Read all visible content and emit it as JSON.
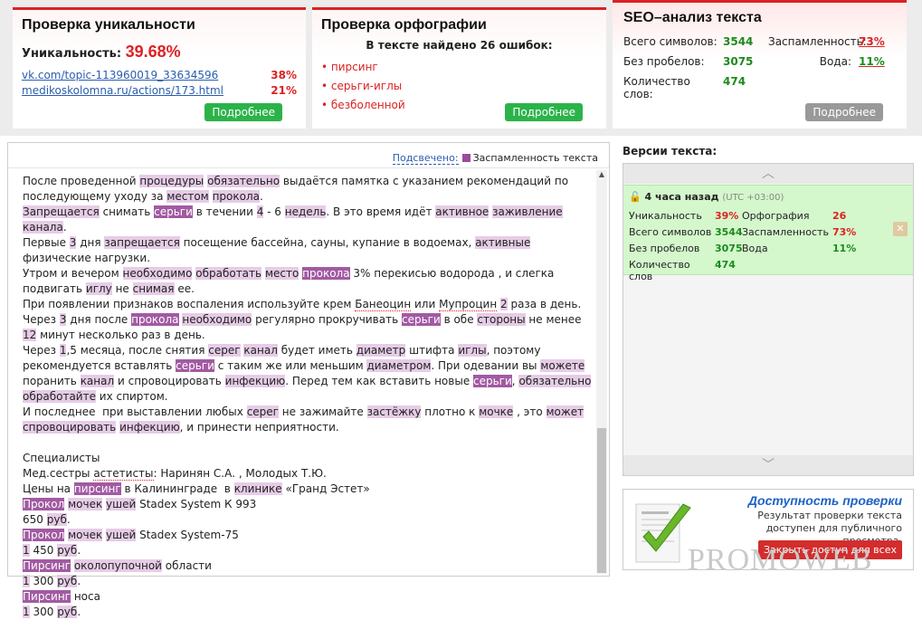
{
  "uniqueness": {
    "title": "Проверка уникальности",
    "label": "Уникальность:",
    "value": "39.68%",
    "sources": [
      {
        "url": "vk.com/topic-113960019_33634596",
        "pct": "38%"
      },
      {
        "url": "medikoskolomna.ru/actions/173.html",
        "pct": "21%"
      }
    ],
    "more": "Подробнее"
  },
  "spelling": {
    "title": "Проверка орфографии",
    "subtitle": "В тексте найдено 26 ошибок:",
    "errors": [
      "пирсинг",
      "серьги-иглы",
      "безболенной"
    ],
    "more": "Подробнее"
  },
  "seo": {
    "title": "SEO–анализ текста",
    "total_label": "Всего символов:",
    "total": "3544",
    "nospace_label": "Без пробелов:",
    "nospace": "3075",
    "words_label": "Количество слов:",
    "words": "474",
    "spam_label": "Заспамленность:",
    "spam": "73%",
    "water_label": "Вода:",
    "water": "11%",
    "more": "Подробнее"
  },
  "editor": {
    "highlight_link": "Подсвечено:",
    "highlight_legend": "Заспамленность текста"
  },
  "versions": {
    "title": "Версии текста:",
    "item": {
      "time": "4 часа назад",
      "tz": "(UTC +03:00)",
      "uniq_label": "Уникальность",
      "uniq": "39%",
      "spell_label": "Орфография",
      "spell": "26",
      "total_label": "Всего символов",
      "total": "3544",
      "spam_label": "Заспамленность",
      "spam": "73%",
      "nospace_label": "Без пробелов",
      "nospace": "3075",
      "water_label": "Вода",
      "water": "11%",
      "words_label": "Количество слов",
      "words": "474"
    }
  },
  "access": {
    "title": "Доступность проверки",
    "desc": "Результат проверки текста доступен для публичного просмотра.",
    "button": "Закрыть доступ для всех",
    "watermark": "PROMOWEB"
  },
  "colors": {
    "accent_red": "#d22",
    "green": "#2bb34a",
    "highlight": "#a25aa2"
  }
}
